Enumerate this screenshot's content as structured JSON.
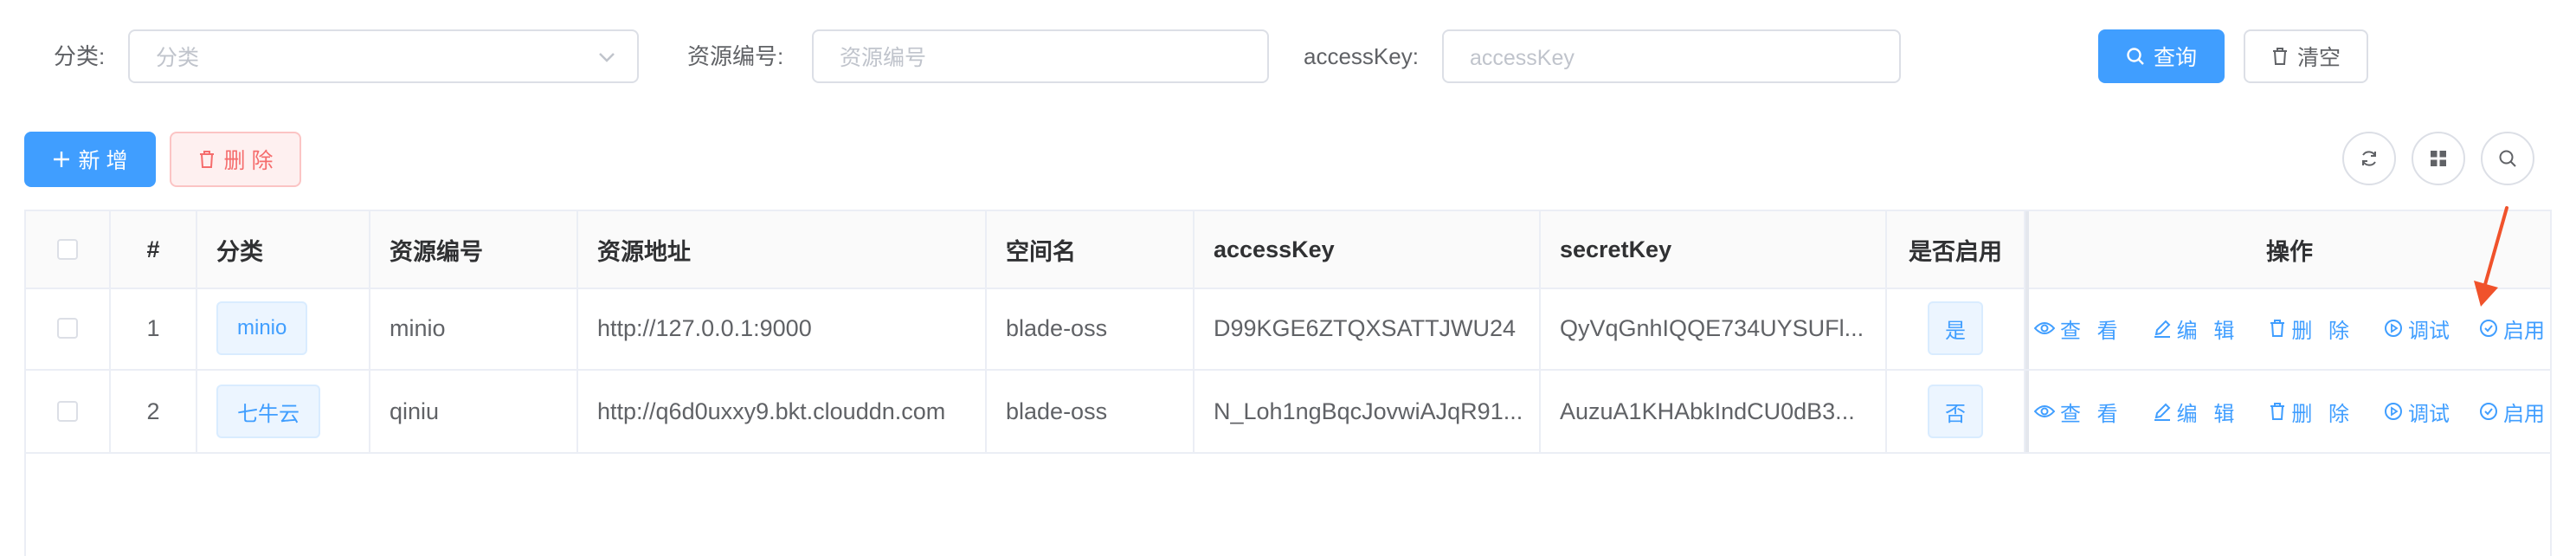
{
  "search": {
    "category_label": "分类:",
    "category_placeholder": "分类",
    "resource_code_label": "资源编号:",
    "resource_code_placeholder": "资源编号",
    "accesskey_label": "accessKey:",
    "accesskey_placeholder": "accessKey",
    "query_button": "查询",
    "clear_button": "清空"
  },
  "toolbar": {
    "add_button": "新 增",
    "delete_button": "删 除"
  },
  "table": {
    "headers": [
      "#",
      "分类",
      "资源编号",
      "资源地址",
      "空间名",
      "accessKey",
      "secretKey",
      "是否启用",
      "操作"
    ],
    "rows": [
      {
        "index": "1",
        "category": "minio",
        "code": "minio",
        "endpoint": "http://127.0.0.1:9000",
        "bucket": "blade-oss",
        "access_key": "D99KGE6ZTQXSATTJWU24",
        "secret_key": "QyVqGnhIQQE734UYSUFl...",
        "enabled": "是"
      },
      {
        "index": "2",
        "category": "七牛云",
        "code": "qiniu",
        "endpoint": "http://q6d0uxxy9.bkt.clouddn.com",
        "bucket": "blade-oss",
        "access_key": "N_Loh1ngBqcJovwiAJqR91...",
        "secret_key": "AuzuA1KHAbkIndCU0dB3...",
        "enabled": "否"
      }
    ],
    "actions": {
      "view": "查 看",
      "edit": "编 辑",
      "delete": "删 除",
      "debug": "调试",
      "enable": "启用"
    }
  },
  "colors": {
    "primary": "#409eff",
    "danger": "#f56c6c",
    "annotation_arrow": "#f0522b"
  }
}
